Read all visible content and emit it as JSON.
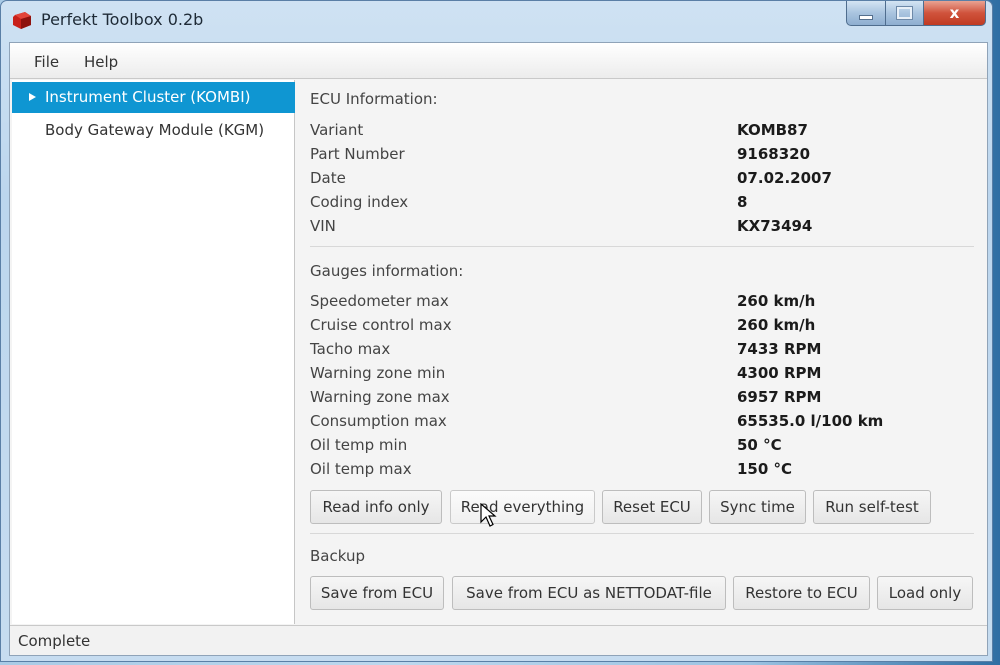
{
  "window": {
    "title": "Perfekt Toolbox 0.2b",
    "caption_buttons": [
      "minimize",
      "maximize",
      "close"
    ],
    "close_glyph": "x"
  },
  "menu": {
    "items": [
      {
        "label": "File"
      },
      {
        "label": "Help"
      }
    ]
  },
  "tree": {
    "items": [
      {
        "label": "Instrument Cluster (KOMBI)",
        "selected": true
      },
      {
        "label": "Body Gateway Module (KGM)",
        "selected": false
      }
    ]
  },
  "ecu": {
    "heading": "ECU Information:",
    "rows": [
      {
        "label": "Variant",
        "value": "KOMB87"
      },
      {
        "label": "Part Number",
        "value": "9168320"
      },
      {
        "label": "Date",
        "value": "07.02.2007"
      },
      {
        "label": "Coding index",
        "value": "8"
      },
      {
        "label": "VIN",
        "value": "KX73494"
      }
    ]
  },
  "gauges": {
    "heading": "Gauges information:",
    "rows": [
      {
        "label": "Speedometer max",
        "value": "260 km/h"
      },
      {
        "label": "Cruise control max",
        "value": "260 km/h"
      },
      {
        "label": "Tacho max",
        "value": "7433 RPM"
      },
      {
        "label": "Warning zone min",
        "value": "4300 RPM"
      },
      {
        "label": "Warning zone max",
        "value": "6957 RPM"
      },
      {
        "label": "Consumption max",
        "value": "65535.0 l/100 km"
      },
      {
        "label": "Oil temp min",
        "value": "50 °C"
      },
      {
        "label": "Oil temp max",
        "value": "150 °C"
      }
    ]
  },
  "actions": {
    "buttons": [
      {
        "label": "Read info only"
      },
      {
        "label": "Read everything"
      },
      {
        "label": "Reset ECU"
      },
      {
        "label": "Sync time"
      },
      {
        "label": "Run self-test"
      }
    ]
  },
  "backup": {
    "heading": "Backup",
    "buttons": [
      {
        "label": "Save from ECU"
      },
      {
        "label": "Save from ECU as NETTODAT-file"
      },
      {
        "label": "Restore to ECU"
      },
      {
        "label": "Load only"
      }
    ]
  },
  "status": {
    "text": "Complete"
  },
  "colors": {
    "selection": "#0f96d2",
    "close_button": "#c03a22"
  }
}
